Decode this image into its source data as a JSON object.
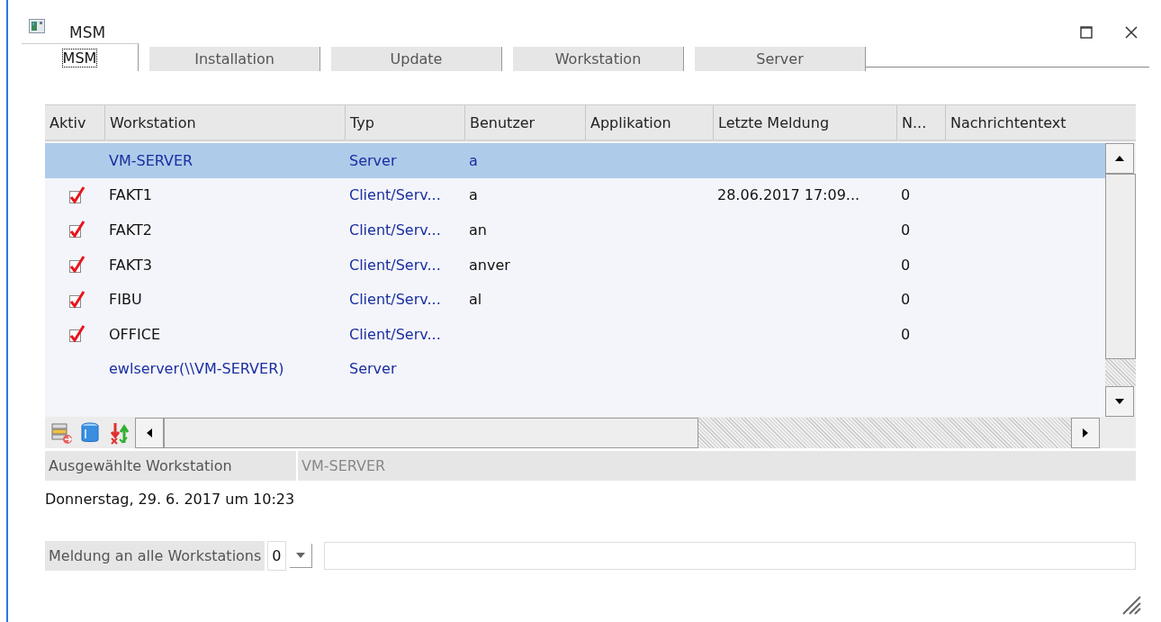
{
  "window": {
    "title": "MSM"
  },
  "tabs": [
    {
      "label": "MSM",
      "selected": true
    },
    {
      "label": "Installation",
      "selected": false
    },
    {
      "label": "Update",
      "selected": false
    },
    {
      "label": "Workstation",
      "selected": false
    },
    {
      "label": "Server",
      "selected": false
    }
  ],
  "table": {
    "columns": [
      "Aktiv",
      "Workstation",
      "Typ",
      "Benutzer",
      "Applikation",
      "Letzte Meldung",
      "N...",
      "Nachrichtentext"
    ],
    "rows": [
      {
        "kind": "server",
        "selected": true,
        "aktiv": false,
        "cells": [
          "",
          "VM-SERVER",
          "Server",
          "a",
          "",
          "",
          "",
          ""
        ]
      },
      {
        "kind": "client",
        "selected": false,
        "aktiv": true,
        "cells": [
          "",
          "FAKT1",
          "Client/Serv...",
          "a",
          "",
          "28.06.2017 17:09...",
          "0",
          ""
        ]
      },
      {
        "kind": "client",
        "selected": false,
        "aktiv": true,
        "cells": [
          "",
          "FAKT2",
          "Client/Serv...",
          "an",
          "",
          "",
          "0",
          ""
        ]
      },
      {
        "kind": "client",
        "selected": false,
        "aktiv": true,
        "cells": [
          "",
          "FAKT3",
          "Client/Serv...",
          "anver",
          "",
          "",
          "0",
          ""
        ]
      },
      {
        "kind": "client",
        "selected": false,
        "aktiv": true,
        "cells": [
          "",
          "FIBU",
          "Client/Serv...",
          "al",
          "",
          "",
          "0",
          ""
        ]
      },
      {
        "kind": "client",
        "selected": false,
        "aktiv": true,
        "cells": [
          "",
          "OFFICE",
          "Client/Serv...",
          "",
          "",
          "",
          "0",
          ""
        ]
      },
      {
        "kind": "server",
        "selected": false,
        "aktiv": false,
        "cells": [
          "",
          "ewlserver(\\\\VM-SERVER)",
          "Server",
          "",
          "",
          "",
          "",
          ""
        ]
      }
    ]
  },
  "selected_workstation": {
    "label": "Ausgewählte Workstation",
    "value": "VM-SERVER"
  },
  "date_line": "Donnerstag, 29. 6. 2017 um 10:23",
  "broadcast": {
    "label": "Meldung an alle Workstations",
    "number": "0"
  }
}
